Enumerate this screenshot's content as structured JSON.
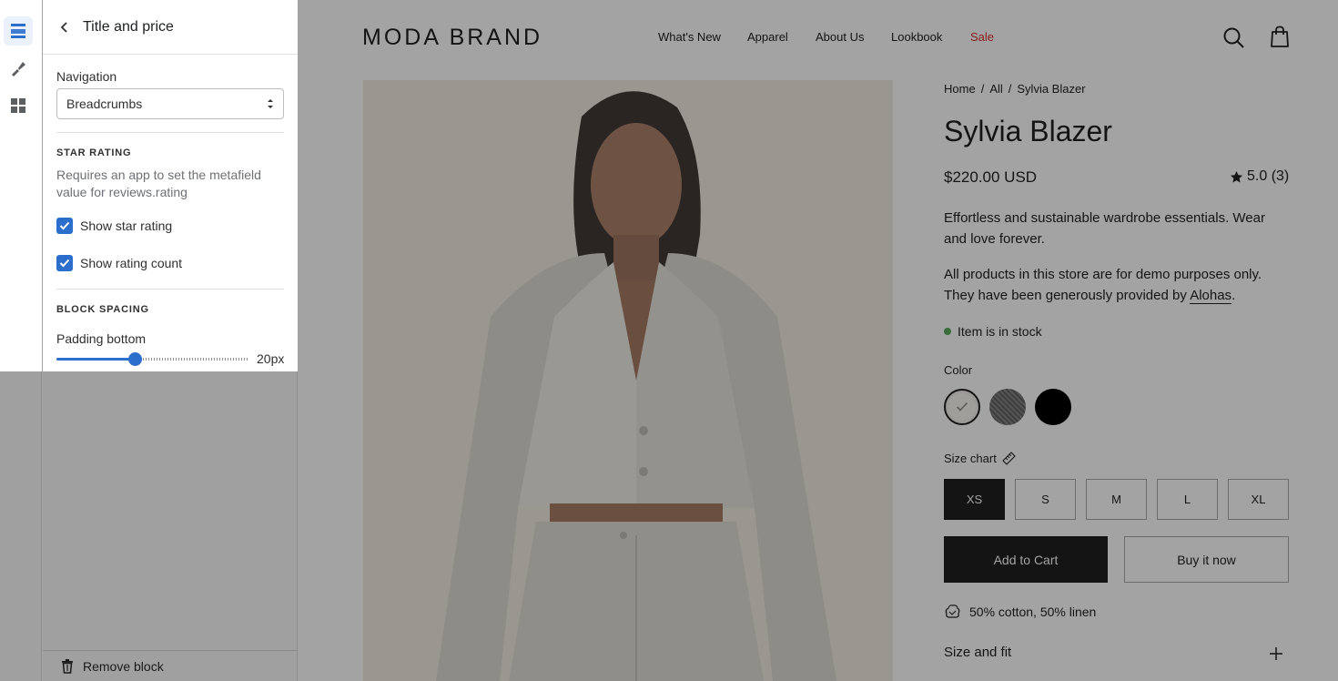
{
  "editor": {
    "rail": [
      {
        "icon": "sections-icon",
        "active": true
      },
      {
        "icon": "theme-settings-icon",
        "active": false
      },
      {
        "icon": "app-embeds-icon",
        "active": false
      }
    ],
    "panel": {
      "title": "Title and price",
      "navigation_label": "Navigation",
      "navigation_value": "Breadcrumbs",
      "star_rating_heading": "STAR RATING",
      "star_rating_help": "Requires an app to set the metafield value for reviews.rating",
      "show_star_rating": "Show star rating",
      "show_rating_count": "Show rating count",
      "block_spacing_heading": "BLOCK SPACING",
      "padding_bottom_label": "Padding bottom",
      "padding_bottom_value": "20px",
      "padding_bottom_fraction": 0.4,
      "remove_block": "Remove block"
    }
  },
  "store": {
    "brand": "MODA BRAND",
    "nav": [
      "What's New",
      "Apparel",
      "About Us",
      "Lookbook",
      "Sale"
    ],
    "breadcrumb": [
      "Home",
      "/",
      "All",
      "/",
      "Sylvia Blazer"
    ],
    "product_title": "Sylvia Blazer",
    "price": "$220.00 USD",
    "rating": "5.0 (3)",
    "description_1": "Effortless and sustainable wardrobe essentials. Wear and love forever.",
    "description_2_prefix": "All products in this store are for demo purposes only. They have been generously provided by ",
    "description_2_link": "Alohas",
    "description_2_suffix": ".",
    "stock": "Item is in stock",
    "color_label": "Color",
    "colors": [
      "#e9e7e3",
      "#5d5d5d",
      "#000000"
    ],
    "size_chart_label": "Size chart",
    "sizes": [
      "XS",
      "S",
      "M",
      "L",
      "XL"
    ],
    "selected_size": "XS",
    "add_to_cart": "Add to Cart",
    "buy_now": "Buy it now",
    "material": "50% cotton, 50% linen",
    "accordion_title": "Size and fit"
  }
}
